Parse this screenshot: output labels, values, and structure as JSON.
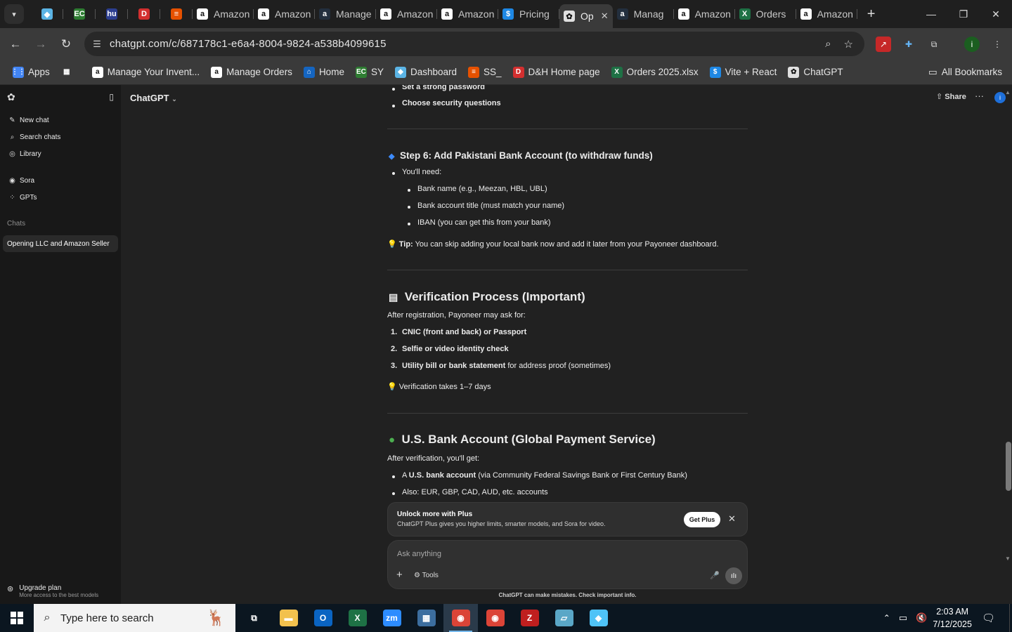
{
  "browser": {
    "tabs": [
      {
        "label": "",
        "icon": "dialogflow-icon",
        "color": "#5bb4e5",
        "glyph": "◆",
        "style": "small"
      },
      {
        "label": "",
        "icon": "ec-icon",
        "color": "#2e7d32",
        "glyph": "EC",
        "style": "small"
      },
      {
        "label": "",
        "icon": "hu-icon",
        "color": "#2c3e8f",
        "glyph": "hu",
        "style": "small"
      },
      {
        "label": "",
        "icon": "dh-icon",
        "color": "#d32f2f",
        "glyph": "D",
        "style": "small"
      },
      {
        "label": "",
        "icon": "stack-icon",
        "color": "#e65100",
        "glyph": "≡",
        "style": "small"
      },
      {
        "label": "Amazon",
        "icon": "amazon-icon",
        "color": "#ffffff",
        "glyph": "a",
        "style": "wide"
      },
      {
        "label": "Amazon",
        "icon": "amazon-icon",
        "color": "#ffffff",
        "glyph": "a",
        "style": "wide"
      },
      {
        "label": "Manage",
        "icon": "amazon-icon",
        "color": "#232f3e",
        "glyph": "a",
        "style": "wide"
      },
      {
        "label": "Amazon",
        "icon": "amazon-icon",
        "color": "#ffffff",
        "glyph": "a",
        "style": "wide"
      },
      {
        "label": "Amazon",
        "icon": "amazon-icon",
        "color": "#ffffff",
        "glyph": "a",
        "style": "wide"
      },
      {
        "label": "Pricing",
        "icon": "dollar-icon",
        "color": "#1e88e5",
        "glyph": "$",
        "style": "wide"
      },
      {
        "label": "Op",
        "icon": "chatgpt-icon",
        "color": "#e0e0e0",
        "glyph": "✿",
        "style": "active"
      },
      {
        "label": "Manag",
        "icon": "amazon-icon",
        "color": "#232f3e",
        "glyph": "a",
        "style": "wide"
      },
      {
        "label": "Amazon",
        "icon": "amazon-icon",
        "color": "#ffffff",
        "glyph": "a",
        "style": "wide"
      },
      {
        "label": "Orders",
        "icon": "excel-icon",
        "color": "#1e7145",
        "glyph": "X",
        "style": "wide"
      },
      {
        "label": "Amazon",
        "icon": "amazon-icon",
        "color": "#ffffff",
        "glyph": "a",
        "style": "wide"
      }
    ],
    "url": "chatgpt.com/c/687178c1-e6a4-8004-9824-a538b4099615",
    "bookmarks": [
      {
        "label": "Apps",
        "icon": "apps-grid-icon",
        "color": "#4285f4",
        "glyph": "⋮⋮"
      },
      {
        "label": "",
        "icon": "tab-groups-icon",
        "color": "#3a3a3a",
        "glyph": "▦"
      },
      {
        "label": "Manage Your Invent...",
        "icon": "amazon-icon",
        "color": "#ffffff",
        "glyph": "a"
      },
      {
        "label": "Manage Orders",
        "icon": "amazon-icon",
        "color": "#ffffff",
        "glyph": "a"
      },
      {
        "label": "Home",
        "icon": "home-icon",
        "color": "#1565c0",
        "glyph": "⌂"
      },
      {
        "label": "SY",
        "icon": "ec-icon",
        "color": "#2e7d32",
        "glyph": "EC"
      },
      {
        "label": "Dashboard",
        "icon": "dialogflow-icon",
        "color": "#5bb4e5",
        "glyph": "◆"
      },
      {
        "label": "SS_",
        "icon": "stack-icon",
        "color": "#e65100",
        "glyph": "≡"
      },
      {
        "label": "D&H Home page",
        "icon": "dh-icon",
        "color": "#d32f2f",
        "glyph": "D"
      },
      {
        "label": "Orders 2025.xlsx",
        "icon": "excel-icon",
        "color": "#1e7145",
        "glyph": "X"
      },
      {
        "label": "Vite + React",
        "icon": "dollar-icon",
        "color": "#1e88e5",
        "glyph": "$"
      },
      {
        "label": "ChatGPT",
        "icon": "chatgpt-icon",
        "color": "#e0e0e0",
        "glyph": "✿"
      }
    ],
    "all_bookmarks": "All Bookmarks"
  },
  "sidebar": {
    "new_chat": "New chat",
    "search_chats": "Search chats",
    "library": "Library",
    "sora": "Sora",
    "gpts": "GPTs",
    "chats_heading": "Chats",
    "active_chat": "Opening LLC and Amazon Seller",
    "upgrade_title": "Upgrade plan",
    "upgrade_sub": "More access to the best models"
  },
  "header": {
    "model": "ChatGPT",
    "share": "Share"
  },
  "conversation": {
    "prev_bullets": [
      "Set a strong password",
      "Choose security questions"
    ],
    "step6_title": "Step 6: Add Pakistani Bank Account (to withdraw funds)",
    "step6_intro": "You'll need:",
    "step6_items": [
      "Bank name (e.g., Meezan, HBL, UBL)",
      "Bank account title (must match your name)",
      "IBAN (you can get this from your bank)"
    ],
    "tip_label": "Tip:",
    "tip_text": "You can skip adding your local bank now and add it later from your Payoneer dashboard.",
    "verify_title": "Verification Process (Important)",
    "verify_intro": "After registration, Payoneer may ask for:",
    "verify_items": [
      {
        "bold": "CNIC (front and back) or Passport",
        "rest": ""
      },
      {
        "bold": "Selfie or video identity check",
        "rest": ""
      },
      {
        "bold": "Utility bill or bank statement",
        "rest": " for address proof (sometimes)"
      }
    ],
    "verify_note": "Verification takes 1–7 days",
    "us_title": "U.S. Bank Account (Global Payment Service)",
    "us_intro": "After verification, you'll get:",
    "us_items": [
      {
        "pre": "A ",
        "bold": "U.S. bank account",
        "rest": " (via Community Federal Savings Bank or First Century Bank)"
      },
      {
        "pre": "",
        "bold": "",
        "rest": "Also: EUR, GBP, CAD, AUD, etc. accounts"
      }
    ]
  },
  "promo": {
    "title": "Unlock more with Plus",
    "subtitle": "ChatGPT Plus gives you higher limits, smarter models, and Sora for video.",
    "button": "Get Plus"
  },
  "composer": {
    "placeholder": "Ask anything",
    "tools": "Tools",
    "disclaimer": "ChatGPT can make mistakes. Check important info."
  },
  "taskbar": {
    "search_placeholder": "Type here to search",
    "apps": [
      {
        "icon": "task-view-icon",
        "color": "#0b1620",
        "glyph": "⧉"
      },
      {
        "icon": "file-explorer-icon",
        "color": "#f2c14e",
        "glyph": "▬"
      },
      {
        "icon": "outlook-icon",
        "color": "#0a64c2",
        "glyph": "O"
      },
      {
        "icon": "excel-icon",
        "color": "#1e7145",
        "glyph": "X"
      },
      {
        "icon": "zoom-icon",
        "color": "#2d8cff",
        "glyph": "zm"
      },
      {
        "icon": "calculator-icon",
        "color": "#3c6e9f",
        "glyph": "▦"
      },
      {
        "icon": "chrome-icon",
        "color": "#db4437",
        "glyph": "◉",
        "active": true
      },
      {
        "icon": "chrome-icon",
        "color": "#db4437",
        "glyph": "◉"
      },
      {
        "icon": "filezilla-icon",
        "color": "#bf1f1f",
        "glyph": "Z"
      },
      {
        "icon": "notepad-icon",
        "color": "#5aa7c7",
        "glyph": "▱"
      },
      {
        "icon": "app-icon",
        "color": "#4fc3f7",
        "glyph": "◆"
      }
    ],
    "time": "2:03 AM",
    "date": "7/12/2025"
  }
}
